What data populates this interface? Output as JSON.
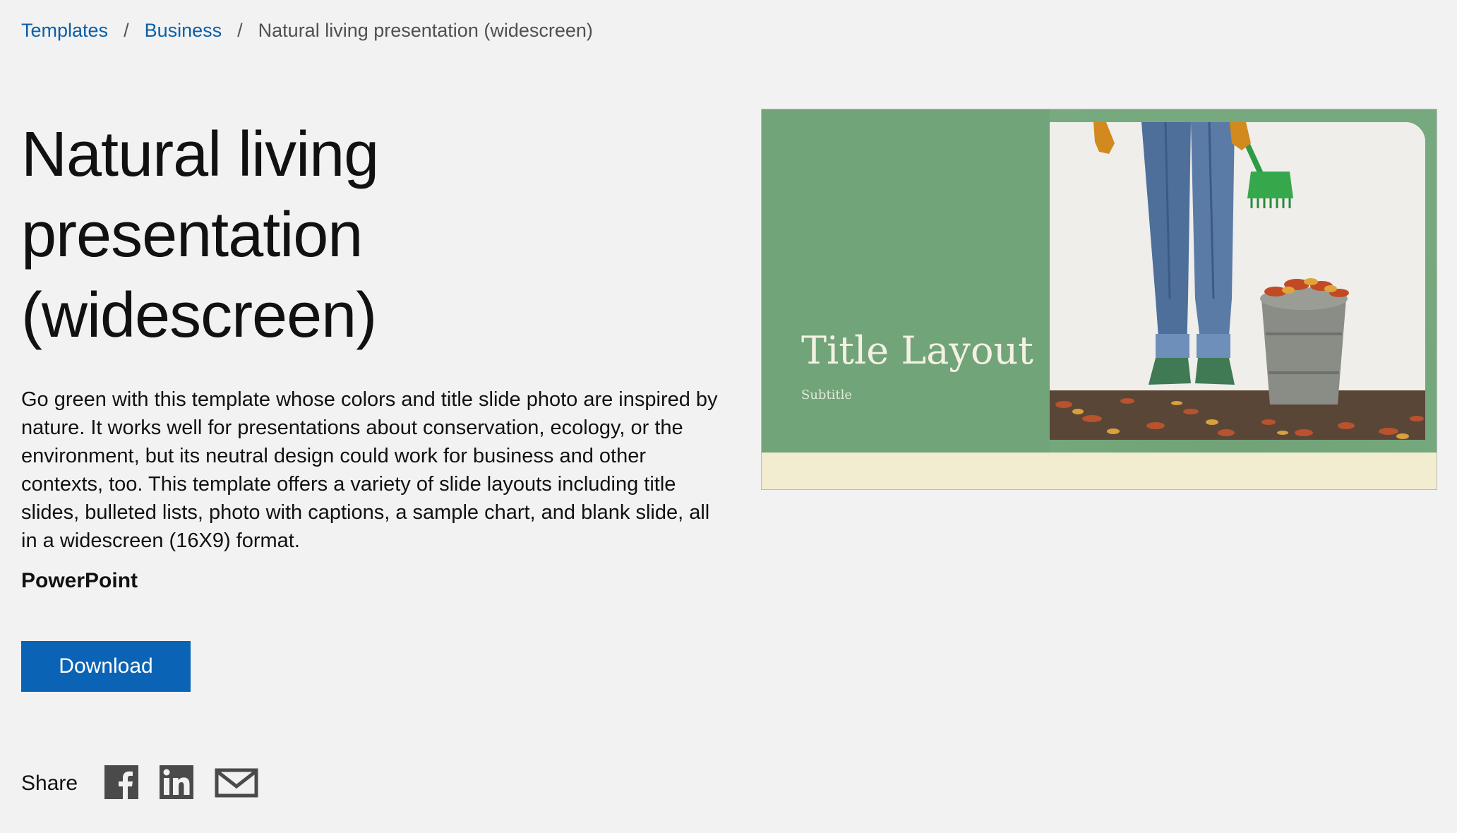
{
  "breadcrumb": {
    "items": [
      {
        "label": "Templates"
      },
      {
        "label": "Business"
      }
    ],
    "separator": "/",
    "current": "Natural living presentation (widescreen)"
  },
  "title": "Natural living presentation (widescreen)",
  "description": "Go green with this template whose colors and title slide photo are inspired by nature. It works well for presentations about conservation, ecology, or the environment, but its neutral design could work for business and other contexts, too. This template offers a variety of slide layouts including title slides, bulleted lists, photo with captions, a sample chart, and blank slide, all in a widescreen (16X9) format.",
  "app": "PowerPoint",
  "download_label": "Download",
  "share": {
    "label": "Share",
    "icons": [
      "facebook-icon",
      "linkedin-icon",
      "email-icon"
    ]
  },
  "preview": {
    "slide_title": "Title Layout",
    "slide_subtitle": "Subtitle"
  },
  "colors": {
    "link": "#0b5fa6",
    "button": "#0b63b5",
    "background": "#f2f2f2",
    "slide_green": "#76a97d",
    "slide_cream": "#f2ecd0"
  }
}
